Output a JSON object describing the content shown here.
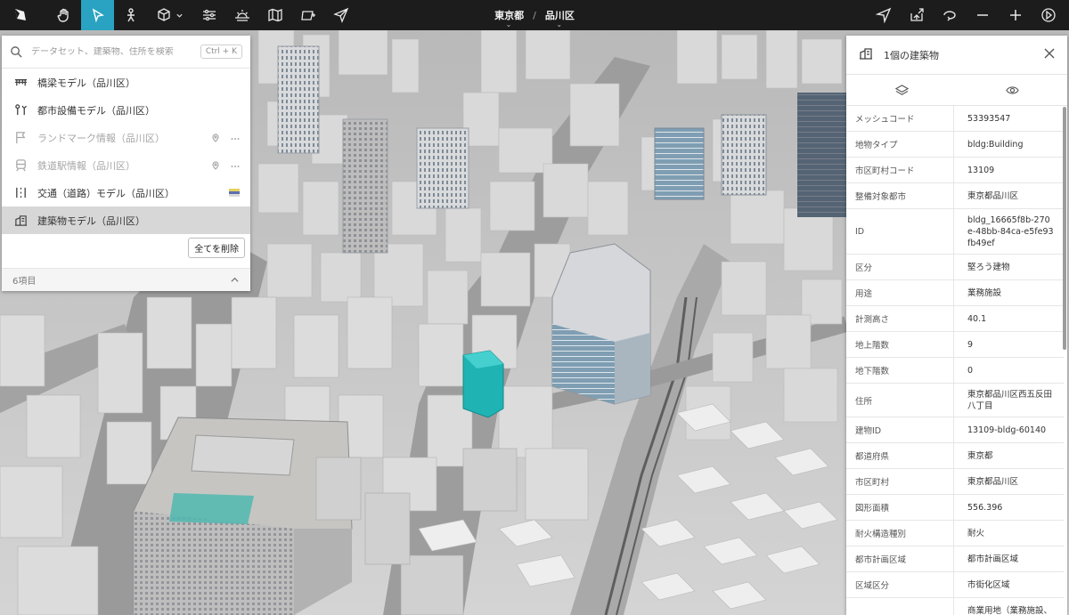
{
  "toolbar": {
    "breadcrumb": [
      "東京都",
      "品川区"
    ],
    "breadcrumb_separator": "/",
    "dropdown_glyph": "⌄",
    "tools_left": [
      "app-logo-icon",
      "hand-icon",
      "cursor-icon",
      "pedestrian-icon",
      "cube-icon",
      "sliders-icon",
      "sunrise-icon",
      "map-icon",
      "layers-plus-icon",
      "send-icon"
    ],
    "tools_right": [
      "locate-icon",
      "share-icon",
      "undo-icon",
      "minus-icon",
      "plus-icon",
      "compass-icon"
    ],
    "active_tool": "cursor-icon",
    "colors": {
      "bar": "#1c1c1c",
      "active": "#29a3c1"
    }
  },
  "left_panel": {
    "search_placeholder": "データセット、建築物、住所を検索",
    "shortcut": "Ctrl + K",
    "items": [
      {
        "label": "橋梁モデル（品川区）",
        "icon": "bridge-icon",
        "state": "normal"
      },
      {
        "label": "都市設備モデル（品川区）",
        "icon": "street-furniture-icon",
        "state": "normal"
      },
      {
        "label": "ランドマーク情報（品川区）",
        "icon": "flag-icon",
        "state": "dim"
      },
      {
        "label": "鉄道駅情報（品川区）",
        "icon": "train-icon",
        "state": "dim"
      },
      {
        "label": "交通（道路）モデル（品川区）",
        "icon": "road-icon",
        "state": "normal"
      },
      {
        "label": "建築物モデル（品川区）",
        "icon": "building-icon",
        "state": "selected"
      }
    ],
    "delete_all": "全てを削除",
    "count": "6項目"
  },
  "right_panel": {
    "title": "1個の建築物",
    "attributes": [
      {
        "key": "メッシュコード",
        "value": "53393547"
      },
      {
        "key": "地物タイプ",
        "value": "bldg:Building"
      },
      {
        "key": "市区町村コード",
        "value": "13109"
      },
      {
        "key": "整備対象都市",
        "value": "東京都品川区"
      },
      {
        "key": "ID",
        "value": "bldg_16665f8b-270e-48bb-84ca-e5fe93fb49ef"
      },
      {
        "key": "区分",
        "value": "堅ろう建物"
      },
      {
        "key": "用途",
        "value": "業務施設"
      },
      {
        "key": "計測高さ",
        "value": "40.1"
      },
      {
        "key": "地上階数",
        "value": "9"
      },
      {
        "key": "地下階数",
        "value": "0"
      },
      {
        "key": "住所",
        "value": "東京都品川区西五反田八丁目"
      },
      {
        "key": "建物ID",
        "value": "13109-bldg-60140"
      },
      {
        "key": "都道府県",
        "value": "東京都"
      },
      {
        "key": "市区町村",
        "value": "東京都品川区"
      },
      {
        "key": "図形面積",
        "value": "556.396"
      },
      {
        "key": "耐火構造種別",
        "value": "耐火"
      },
      {
        "key": "都市計画区域",
        "value": "都市計画区域"
      },
      {
        "key": "区域区分",
        "value": "市街化区域"
      },
      {
        "key": "",
        "value": "商業用地（業務施設、"
      }
    ]
  },
  "map": {
    "highlight_color": "#1fb3b3",
    "ground": "#c9c9c9",
    "road": "#8a8a8a"
  }
}
